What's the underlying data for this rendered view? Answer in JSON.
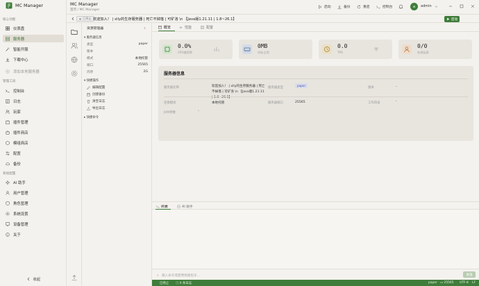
{
  "app": {
    "title": "MC Manager"
  },
  "sidebar": {
    "sections": [
      {
        "title": "核心功能",
        "items": [
          {
            "label": "仪表盘",
            "icon": "dashboard-icon",
            "active": false
          },
          {
            "label": "服务器",
            "icon": "server-icon",
            "active": true
          },
          {
            "label": "智能开服",
            "icon": "wand-icon",
            "active": false
          },
          {
            "label": "下载中心",
            "icon": "download-icon",
            "active": false
          },
          {
            "label": "添加本地服务器",
            "icon": "plus-circle-icon",
            "active": false,
            "muted": true
          }
        ]
      },
      {
        "title": "管理工具",
        "items": [
          {
            "label": "控制台",
            "icon": "terminal-icon"
          },
          {
            "label": "日志",
            "icon": "log-icon"
          },
          {
            "label": "玩家",
            "icon": "players-icon"
          },
          {
            "label": "插件管理",
            "icon": "plugin-icon"
          },
          {
            "label": "插件商店",
            "icon": "store-icon"
          },
          {
            "label": "模组商店",
            "icon": "mod-store-icon"
          },
          {
            "label": "配置",
            "icon": "config-icon"
          },
          {
            "label": "备份",
            "icon": "backup-icon"
          }
        ]
      },
      {
        "title": "系统配置",
        "items": [
          {
            "label": "AI 助手",
            "icon": "ai-icon"
          },
          {
            "label": "用户管理",
            "icon": "users-icon"
          },
          {
            "label": "角色管理",
            "icon": "roles-icon"
          },
          {
            "label": "系统设置",
            "icon": "settings-icon"
          },
          {
            "label": "设备管理",
            "icon": "device-icon"
          },
          {
            "label": "关于",
            "icon": "about-icon"
          }
        ]
      }
    ],
    "collapse_label": "收起"
  },
  "header": {
    "title": "MC Manager",
    "breadcrumb": "首页 / MC Manager",
    "buttons": [
      {
        "label": "启动",
        "icon": "play-icon"
      },
      {
        "label": "备份",
        "icon": "backup-icon"
      },
      {
        "label": "重启",
        "icon": "restart-icon"
      },
      {
        "label": "控制台",
        "icon": "terminal-icon"
      }
    ],
    "user": {
      "name": "admin",
      "avatar_letter": "a"
    }
  },
  "server_bar": {
    "status": "已停止",
    "name": "欢迎加入！ | xlly的生存服务器 | 死亡不掉落 | 可矿洛 \\n 【Java版1.21.11 | 1.8~26.1】",
    "start_label": "启动"
  },
  "file_panel": {
    "title": "资源管理器",
    "info_header": "服务器信息",
    "info": [
      {
        "k": "类型",
        "v": "paper"
      },
      {
        "k": "版本",
        "v": ""
      },
      {
        "k": "模式",
        "v": "本地托管"
      },
      {
        "k": "端口",
        "v": "25565"
      },
      {
        "k": "内存",
        "v": "2G"
      }
    ],
    "ops_header": "快捷操作",
    "ops": [
      {
        "label": "编辑配置",
        "icon": "edit-icon"
      },
      {
        "label": "创建备份",
        "icon": "backup-icon"
      },
      {
        "label": "清空日志",
        "icon": "trash-icon"
      },
      {
        "label": "导出日志",
        "icon": "export-icon"
      }
    ],
    "cmd_header": "快捷命令"
  },
  "tabs": [
    {
      "label": "概览",
      "icon": "overview-icon",
      "active": true
    },
    {
      "label": "性能",
      "icon": "performance-icon",
      "active": false
    },
    {
      "label": "配置",
      "icon": "config-icon",
      "active": false
    }
  ],
  "stats": [
    {
      "value": "0.0%",
      "label": "CPU使用率",
      "icon": "cpu-icon",
      "color": "#d5e6d0"
    },
    {
      "value": "0MB",
      "label": "内存占用",
      "icon": "memory-icon",
      "color": "#d3dbe9"
    },
    {
      "value": "0.0",
      "label": "TPS",
      "icon": "clock-icon",
      "color": "#ece0c3"
    },
    {
      "value": "0/0",
      "label": "在线玩家",
      "icon": "user-icon",
      "color": "#efdccb"
    }
  ],
  "server_info": {
    "title": "服务器信息",
    "name_key": "服务器名称",
    "name_val": "欢迎加入！ | xlly的生存服务器 | 死亡不掉落 | 可矿洛 \\n 【Java版1.21.11 | 1.8~26.1】",
    "type_key": "服务器类型",
    "type_val": "paper",
    "version_key": "版本",
    "version_val": "-",
    "conn_key": "连接模式",
    "conn_val": "本地托管",
    "port_key": "服务器端口",
    "port_val": "25565",
    "workdir_key": "工作目录",
    "workdir_val": "-",
    "jvm_key": "JVM参数",
    "jvm_val": "-"
  },
  "console": {
    "tabs": [
      {
        "label": "终端",
        "icon": "terminal-icon",
        "active": true
      },
      {
        "label": "AI 助手",
        "icon": "ai-icon",
        "active": false
      }
    ],
    "placeholder": "输入命令或使用快捷指令...",
    "send_label": "发送"
  },
  "statusbar": {
    "state": "已停止",
    "logs": "0 条日志",
    "type": "paper",
    "port": "25565",
    "encoding": "UTF-8",
    "line_ending": "LF"
  }
}
